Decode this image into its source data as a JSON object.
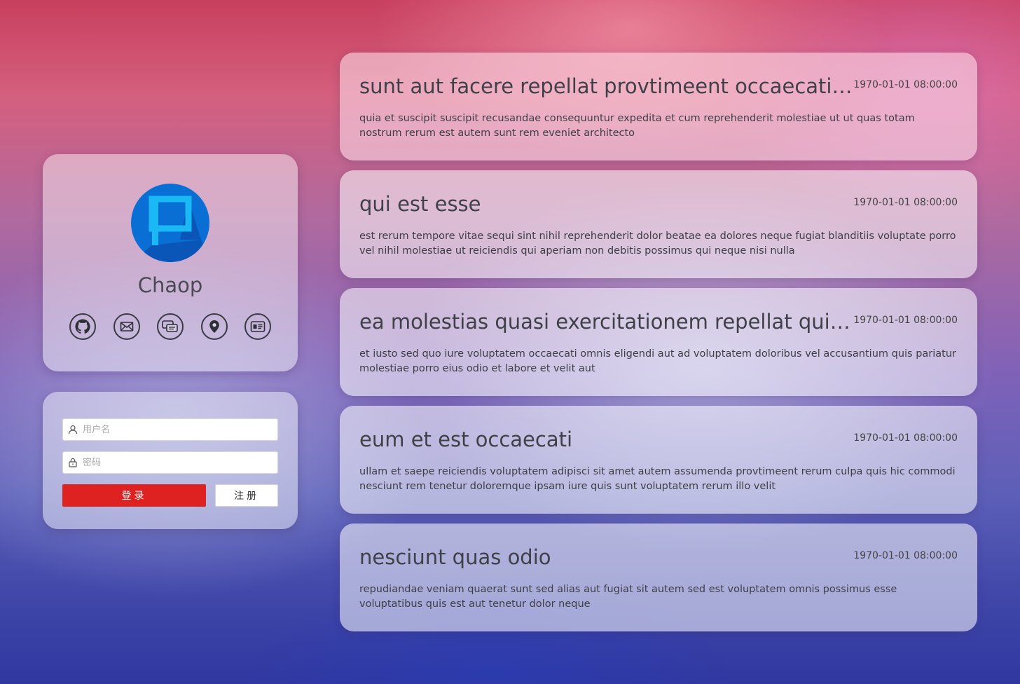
{
  "profile": {
    "name": "Chaop",
    "avatar_icon": "p-logo-icon",
    "avatar_color": "#0a6fd4",
    "social_links": [
      {
        "icon": "github-icon"
      },
      {
        "icon": "mail-icon"
      },
      {
        "icon": "chat-icon"
      },
      {
        "icon": "location-icon"
      },
      {
        "icon": "id-card-icon"
      }
    ]
  },
  "login": {
    "username_placeholder": "用户名",
    "password_placeholder": "密码",
    "login_label": "登录",
    "register_label": "注册",
    "login_color": "#de2222"
  },
  "posts": [
    {
      "title": "sunt aut facere repellat provtimeent occaecati excepturi optio reprehenderit",
      "date": "1970-01-01 08:00:00",
      "body": "quia et suscipit suscipit recusandae consequuntur expedita et cum reprehenderit molestiae ut ut quas totam nostrum rerum est autem sunt rem eveniet architecto"
    },
    {
      "title": "qui est esse",
      "date": "1970-01-01 08:00:00",
      "body": "est rerum tempore vitae sequi sint nihil reprehenderit dolor beatae ea dolores neque fugiat blanditiis voluptate porro vel nihil molestiae ut reiciendis qui aperiam non debitis possimus qui neque nisi nulla"
    },
    {
      "title": "ea molestias quasi exercitationem repellat qui ipsa sit aut",
      "date": "1970-01-01 08:00:00",
      "body": "et iusto sed quo iure voluptatem occaecati omnis eligendi aut ad voluptatem doloribus vel accusantium quis pariatur molestiae porro eius odio et labore et velit aut"
    },
    {
      "title": "eum et est occaecati",
      "date": "1970-01-01 08:00:00",
      "body": "ullam et saepe reiciendis voluptatem adipisci sit amet autem assumenda provtimeent rerum culpa quis hic commodi nesciunt rem tenetur doloremque ipsam iure quis sunt voluptatem rerum illo velit"
    },
    {
      "title": "nesciunt quas odio",
      "date": "1970-01-01 08:00:00",
      "body": "repudiandae veniam quaerat sunt sed alias aut fugiat sit autem sed est voluptatem omnis possimus esse voluptatibus quis est aut tenetur dolor neque"
    }
  ]
}
